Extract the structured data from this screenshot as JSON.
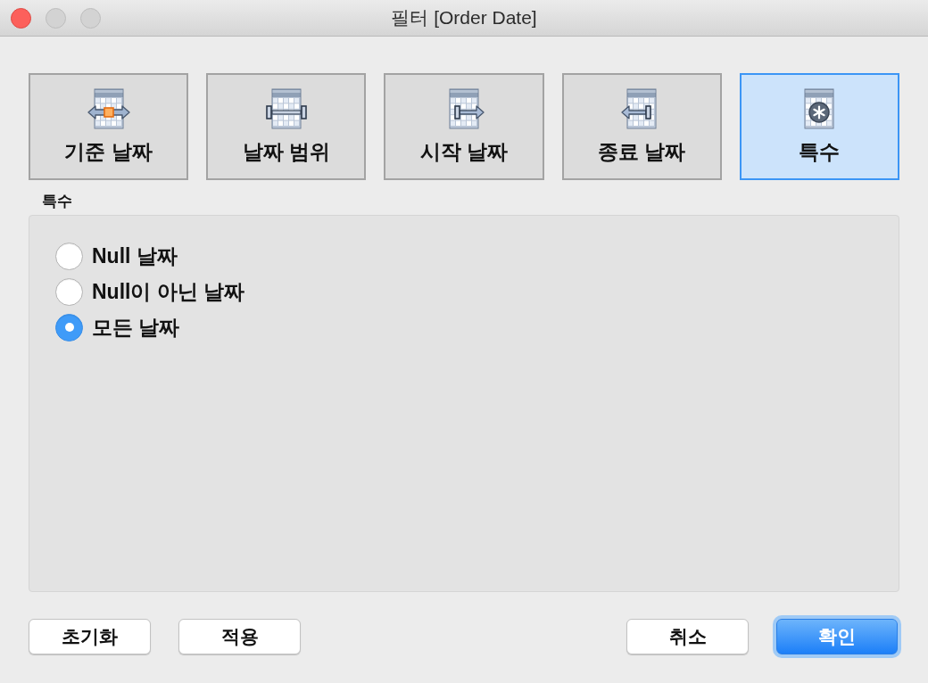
{
  "window": {
    "title": "필터 [Order Date]"
  },
  "tabs": [
    {
      "label": "기준 날짜",
      "kind": "anchor",
      "selected": false
    },
    {
      "label": "날짜 범위",
      "kind": "range",
      "selected": false
    },
    {
      "label": "시작 날짜",
      "kind": "start",
      "selected": false
    },
    {
      "label": "종료 날짜",
      "kind": "end",
      "selected": false
    },
    {
      "label": "특수",
      "kind": "special",
      "selected": true
    }
  ],
  "section": {
    "title": "특수",
    "options": [
      {
        "label": "Null 날짜",
        "selected": false
      },
      {
        "label": "Null이 아닌 날짜",
        "selected": false
      },
      {
        "label": "모든 날짜",
        "selected": true
      }
    ]
  },
  "footer": {
    "left_buttons": [
      {
        "label": "초기화",
        "kind": "plain"
      },
      {
        "label": "적용",
        "kind": "plain"
      }
    ],
    "right_buttons": [
      {
        "label": "취소",
        "kind": "plain"
      },
      {
        "label": "확인",
        "kind": "primary"
      }
    ]
  }
}
